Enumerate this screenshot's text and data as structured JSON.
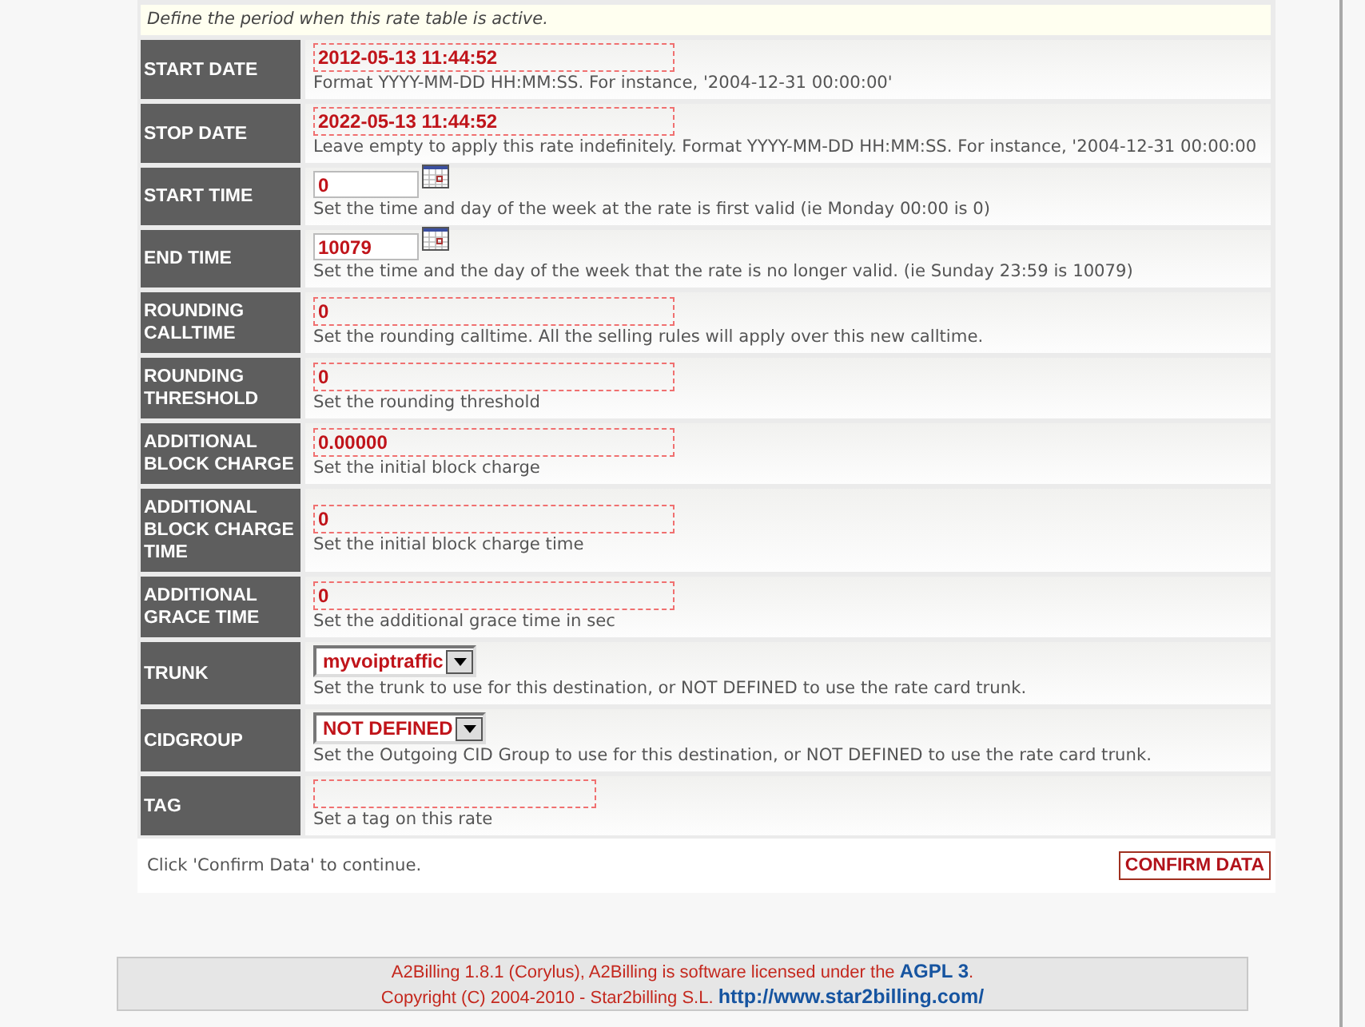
{
  "hint": "Define the period when this rate table is active.",
  "fields": [
    {
      "label": "START DATE",
      "kind": "text",
      "value": "2012-05-13 11:44:52",
      "description": "Format YYYY-MM-DD HH:MM:SS. For instance, '2004-12-31 00:00:00'"
    },
    {
      "label": "STOP DATE",
      "kind": "text",
      "value": "2022-05-13 11:44:52",
      "description": "Leave empty to apply this rate indefinitely. Format YYYY-MM-DD HH:MM:SS. For instance, '2004-12-31 00:00:00"
    },
    {
      "label": "START TIME",
      "kind": "calendar",
      "value": "0",
      "description": "Set the time and day of the week at the rate is first valid (ie Monday 00:00 is 0)"
    },
    {
      "label": "END TIME",
      "kind": "calendar",
      "value": "10079",
      "description": "Set the time and the day of the week that the rate is no longer valid. (ie Sunday 23:59 is 10079)"
    },
    {
      "label": "ROUNDING CALLTIME",
      "kind": "text",
      "value": "0",
      "description": "Set the rounding calltime. All the selling rules will apply over this new calltime."
    },
    {
      "label": "ROUNDING THRESHOLD",
      "kind": "text",
      "value": "0",
      "description": "Set the rounding threshold"
    },
    {
      "label": "ADDITIONAL BLOCK CHARGE",
      "kind": "text",
      "value": "0.00000",
      "description": "Set the initial block charge"
    },
    {
      "label": "ADDITIONAL BLOCK CHARGE TIME",
      "kind": "text",
      "value": "0",
      "description": "Set the initial block charge time"
    },
    {
      "label": "ADDITIONAL GRACE TIME",
      "kind": "text",
      "value": "0",
      "description": "Set the additional grace time in sec"
    },
    {
      "label": "TRUNK",
      "kind": "select",
      "value": "myvoiptraffic",
      "description": "Set the trunk to use for this destination, or NOT DEFINED to use the rate card trunk."
    },
    {
      "label": "CIDGROUP",
      "kind": "select",
      "value": "NOT DEFINED",
      "description": "Set the Outgoing CID Group to use for this destination, or NOT DEFINED to use the rate card trunk."
    },
    {
      "label": "TAG",
      "kind": "tag",
      "description": "Set a tag on this rate"
    }
  ],
  "instruction": "Click 'Confirm Data' to continue.",
  "confirm_button": "CONFIRM DATA",
  "footer": {
    "line_1": "A2Billing 1.8.1 (Corylus), A2Billing is software licensed under the",
    "link_1": "AGPL 3",
    "line_1_end": ".",
    "line_2": "Copyright (C) 2004-2010 - Star2billing S.L.",
    "link_2": "http://www.star2billing.com/"
  }
}
